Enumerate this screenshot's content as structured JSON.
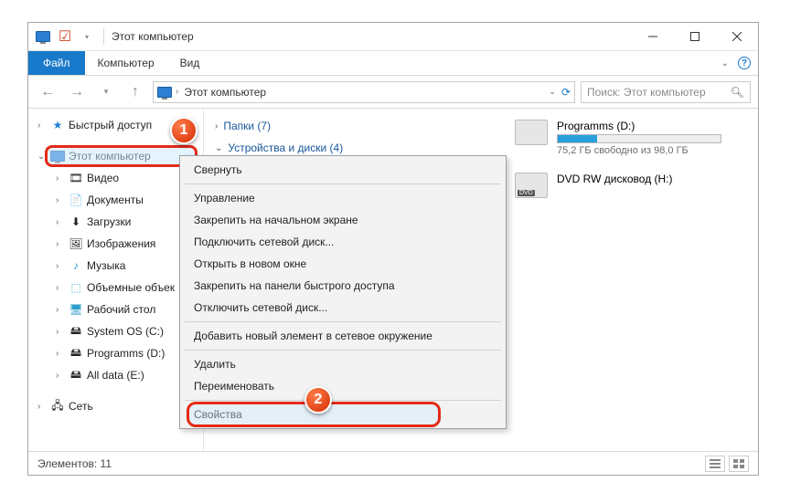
{
  "title": "Этот компьютер",
  "ribbon": {
    "file": "Файл",
    "computer": "Компьютер",
    "view": "Вид"
  },
  "breadcrumb": "Этот компьютер",
  "search_placeholder": "Поиск: Этот компьютер",
  "nav": {
    "quick": "Быстрый доступ",
    "thispc": "Этот компьютер",
    "children": [
      "Видео",
      "Документы",
      "Загрузки",
      "Изображения",
      "Музыка",
      "Объемные объек",
      "Рабочий стол",
      "System OS (C:)",
      "Programms (D:)",
      "All data (E:)"
    ],
    "network": "Сеть"
  },
  "sections": {
    "folders": "Папки (7)",
    "devices": "Устройства и диски (4)"
  },
  "drives": [
    {
      "name": "Programms (D:)",
      "free": "75,2 ГБ свободно из 98,0 ГБ",
      "fill": 24,
      "type": "hdd"
    },
    {
      "name": "DVD RW дисковод (H:)",
      "free": "",
      "fill": 0,
      "type": "dvd"
    }
  ],
  "ctx": {
    "collapse": "Свернуть",
    "manage": "Управление",
    "pin_start": "Закрепить на начальном экране",
    "map": "Подключить сетевой диск...",
    "new_win": "Открыть в новом окне",
    "pin_quick": "Закрепить на панели быстрого доступа",
    "disconnect": "Отключить сетевой диск...",
    "add_net": "Добавить новый элемент в сетевое окружение",
    "delete": "Удалить",
    "rename": "Переименовать",
    "props": "Свойства"
  },
  "status": {
    "elements": "Элементов: 11"
  },
  "badges": {
    "one": "1",
    "two": "2"
  }
}
